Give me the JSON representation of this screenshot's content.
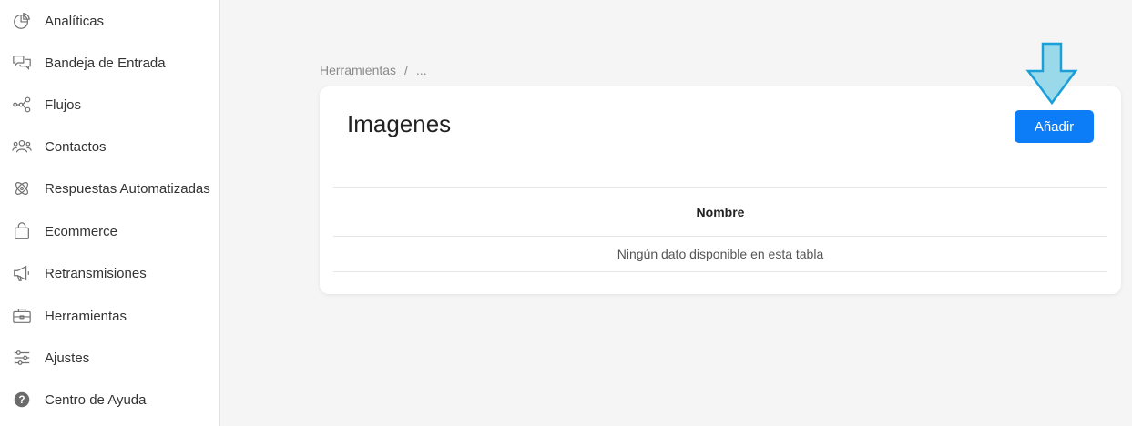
{
  "sidebar": {
    "items": [
      {
        "label": "Analíticas",
        "icon": "pie-chart-icon"
      },
      {
        "label": "Bandeja de Entrada",
        "icon": "chat-bubbles-icon"
      },
      {
        "label": "Flujos",
        "icon": "flow-nodes-icon"
      },
      {
        "label": "Contactos",
        "icon": "users-icon"
      },
      {
        "label": "Respuestas Automatizadas",
        "icon": "atom-icon"
      },
      {
        "label": "Ecommerce",
        "icon": "shopping-bag-icon"
      },
      {
        "label": "Retransmisiones",
        "icon": "megaphone-icon"
      },
      {
        "label": "Herramientas",
        "icon": "toolbox-icon"
      },
      {
        "label": "Ajustes",
        "icon": "sliders-icon"
      },
      {
        "label": "Centro de Ayuda",
        "icon": "help-circle-icon"
      }
    ]
  },
  "breadcrumb": {
    "root": "Herramientas",
    "separator": "/",
    "current": "..."
  },
  "card": {
    "title": "Imagenes",
    "add_label": "Añadir",
    "table": {
      "columns": [
        "Nombre"
      ],
      "empty_message": "Ningún dato disponible en esta tabla"
    }
  },
  "colors": {
    "accent": "#0d7df7",
    "arrow_fill": "#99d9ea",
    "arrow_stroke": "#1a9fd8"
  }
}
